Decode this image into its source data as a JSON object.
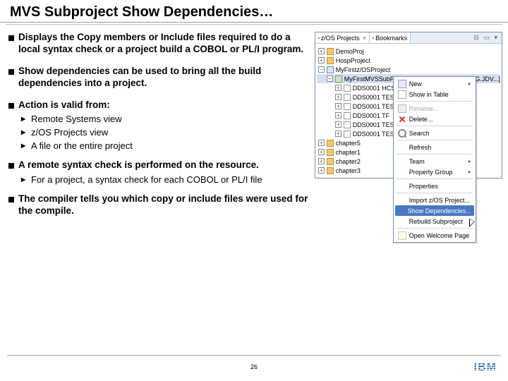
{
  "title": "MVS Subproject Show Dependencies…",
  "bullets": {
    "b1": "Displays the Copy members or Include files required to do a local syntax check or a project build a COBOL or PL/I program.",
    "b2": "Show dependencies can be used to bring all the build dependencies into a project.",
    "b3": "Action is valid from:",
    "b3subs": [
      "Remote Systems view",
      "z/OS Projects view",
      "A file or the entire project"
    ],
    "b4": "A remote syntax check is performed on the resource.",
    "b4subs": [
      "For a project, a syntax check for each COBOL or PL/I file"
    ],
    "b5": "The compiler tells you which copy or include files were used for the compile."
  },
  "screenshot": {
    "tabs": {
      "tab1": "z/OS Projects",
      "tab2": "Bookmarks"
    },
    "tree": {
      "n1": "DemoProj",
      "n2": "HospProject",
      "n3": "MyFirstz/OSProject",
      "n4": "MyFirstMVSSubProject  [DTMOMVS.DEMOPKG.JDV...]",
      "ds1": "DDS0001 HCS",
      "ds2": "DDS0001 TES",
      "ds3": "DDS0001 TES",
      "ds4": "DDS0001 TF",
      "ds5": "DDS0001 TES",
      "ds6": "DDS0001 TES",
      "c5": "chapter5",
      "c1": "chapter1",
      "c2": "chapter2",
      "c3": "chapter3"
    },
    "menu": {
      "new": "New",
      "show_table": "Show in Table",
      "rename": "Rename...",
      "delete": "Delete...",
      "search": "Search",
      "refresh": "Refresh",
      "team": "Team",
      "prop_group": "Property Group",
      "properties": "Properties",
      "import": "Import z/OS Project...",
      "show_deps": "Show Dependencies...",
      "rebuild": "Rebuild Subproject",
      "open_welcome": "Open Welcome Page"
    }
  },
  "footer": {
    "page": "26",
    "logo": "IBM"
  }
}
